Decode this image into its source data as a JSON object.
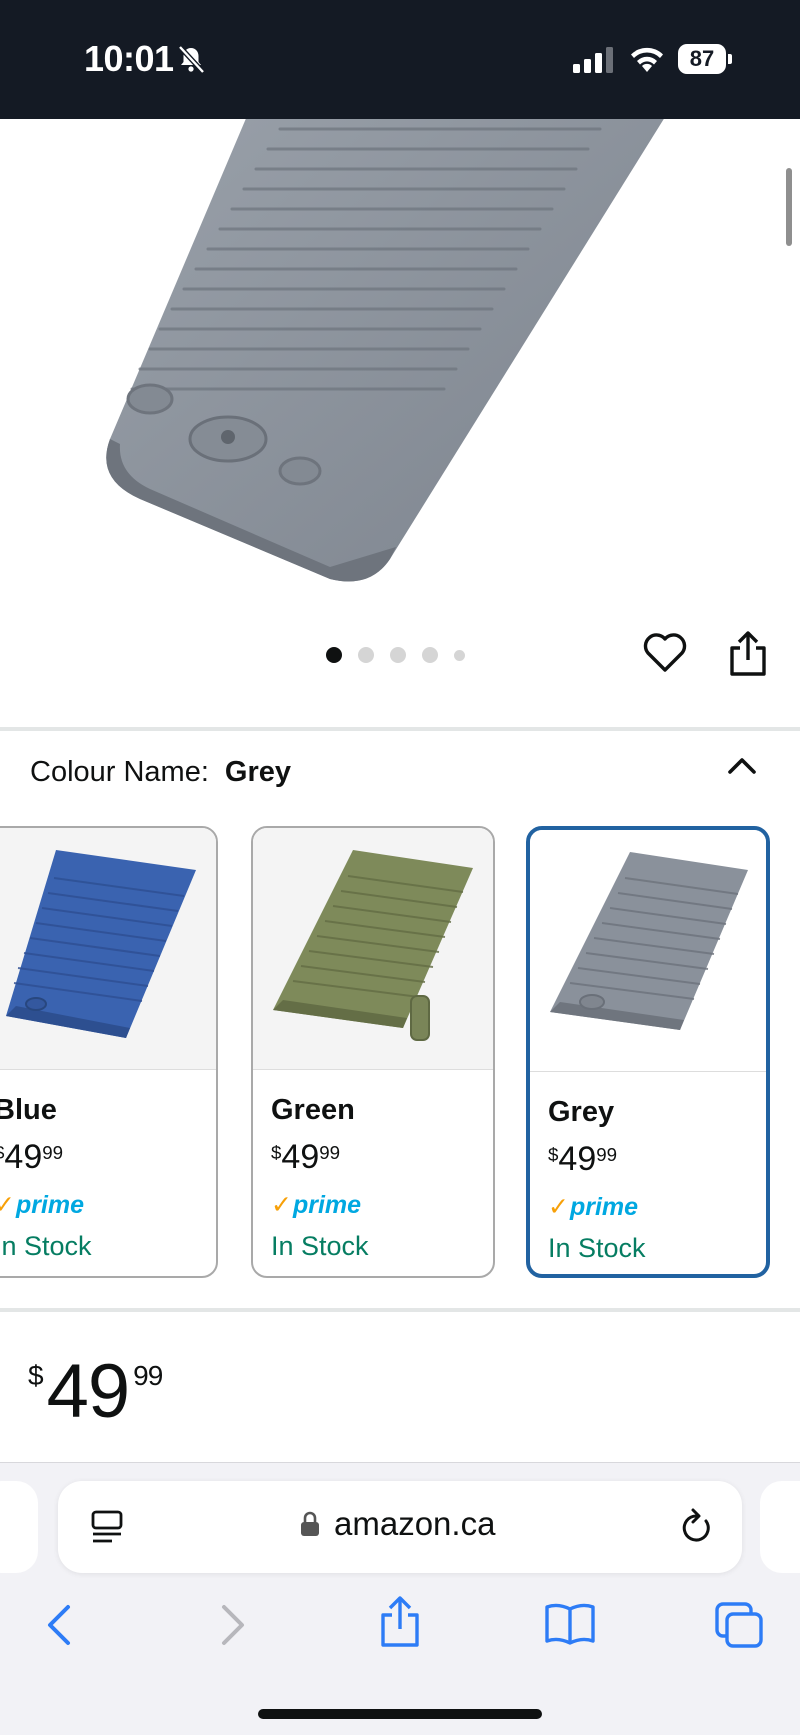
{
  "status_bar": {
    "time": "10:01",
    "battery": "87",
    "bell_icon": "bell-slash-icon",
    "signal_icon": "cellular-signal-icon",
    "wifi_icon": "wifi-icon"
  },
  "product": {
    "image_alt_icon": "air-mattress-image",
    "carousel": {
      "total_dots": 5,
      "active_index": 0
    },
    "actions": {
      "wishlist_icon": "heart-icon",
      "share_icon": "share-icon"
    }
  },
  "variation": {
    "label": "Colour Name:",
    "selected_value": "Grey",
    "collapse_icon": "chevron-up-icon",
    "swatches": [
      {
        "name": "Blue",
        "price_currency": "$",
        "price_whole": "49",
        "price_fraction": "99",
        "prime": "prime",
        "stock": "In Stock",
        "color": "#3a63b0",
        "selected": false
      },
      {
        "name": "Green",
        "price_currency": "$",
        "price_whole": "49",
        "price_fraction": "99",
        "prime": "prime",
        "stock": "In Stock",
        "color": "#7e8a5a",
        "selected": false
      },
      {
        "name": "Grey",
        "price_currency": "$",
        "price_whole": "49",
        "price_fraction": "99",
        "prime": "prime",
        "stock": "In Stock",
        "color": "#8a919b",
        "selected": true
      }
    ]
  },
  "price": {
    "currency": "$",
    "whole": "49",
    "fraction": "99"
  },
  "browser": {
    "url": "amazon.ca",
    "reader_icon": "reader-mode-icon",
    "lock_icon": "lock-icon",
    "reload_icon": "reload-icon",
    "toolbar": [
      "back-icon",
      "forward-icon",
      "share-icon",
      "bookmarks-icon",
      "tabs-icon"
    ]
  },
  "colors": {
    "status_bg": "#141a24",
    "accent_selected": "#2162a1",
    "stock_green": "#067d62",
    "prime_blue": "#00a8e1",
    "safari_blue": "#2d7cf6"
  }
}
